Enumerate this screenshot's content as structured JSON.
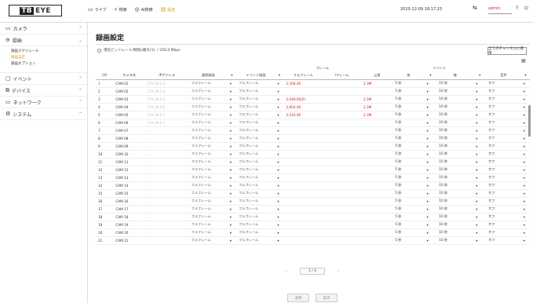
{
  "header": {
    "logo_left": "TB",
    "logo_right": "EYE",
    "nav": [
      {
        "label": "ライブ",
        "icon": "live-icon"
      },
      {
        "label": "検索",
        "icon": "search-icon"
      },
      {
        "label": "AI検索",
        "icon": "ai-search-icon"
      },
      {
        "label": "設定",
        "icon": "settings-icon"
      }
    ],
    "datetime": "2020-12-09 18:17:23",
    "user": "admin",
    "help": "?"
  },
  "sidebar": {
    "items": [
      {
        "label": "カメラ",
        "icon": "camera-icon",
        "expanded": false
      },
      {
        "label": "録画",
        "icon": "record-icon",
        "expanded": true,
        "subs": [
          "録画スケジュール",
          "録画設定",
          "録画オプション"
        ]
      },
      {
        "label": "イベント",
        "icon": "event-icon",
        "expanded": false
      },
      {
        "label": "デバイス",
        "icon": "device-icon",
        "expanded": false
      },
      {
        "label": "ネットワーク",
        "icon": "network-icon",
        "expanded": false
      },
      {
        "label": "システム",
        "icon": "system-icon",
        "expanded": false
      }
    ]
  },
  "main": {
    "title": "録画設定",
    "bitrate_label": "現在ビットレート(制限)/最大(1)",
    "bitrate_value": "/ 256.0 Mbps",
    "all_channel_btn": "全てのチャンネルに適用",
    "table": {
      "group_frame": "フレーム",
      "group_event": "イベント",
      "headers": [
        "CH",
        "カメラ名",
        "IPアドレス",
        "連続録画",
        "",
        "イベント録画",
        "",
        "フルフレーム",
        "Iフレーム",
        "上限",
        "前",
        "",
        "後",
        "",
        "音声",
        ""
      ],
      "rows": [
        [
          "1",
          "CAM 01",
          "172.30.2.3",
          "フルフレーム",
          "フルフレーム",
          "2,168.00",
          "",
          "2.3M",
          "5 秒",
          "10 秒",
          "オフ"
        ],
        [
          "2",
          "CAM 02",
          "172.30.2.4",
          "フルフレーム",
          "フルフレーム",
          "",
          "",
          "",
          "5 秒",
          "10 秒",
          "オフ"
        ],
        [
          "3",
          "CAM 03",
          "172.30.2.5",
          "フルフレーム",
          "フルフレーム",
          "2,048.00(0)",
          "",
          "2.3M",
          "5 秒",
          "10 秒",
          "オフ"
        ],
        [
          "4",
          "CAM 04",
          "172.30.2.6",
          "フルフレーム",
          "フルフレーム",
          "2,664.00",
          "",
          "2.3M",
          "5 秒",
          "10 秒",
          "オフ"
        ],
        [
          "5",
          "CAM 05",
          "172.30.2.7",
          "フルフレーム",
          "フルフレーム",
          "2,144.00",
          "",
          "2.3M",
          "5 秒",
          "10 秒",
          "オフ"
        ],
        [
          "6",
          "CAM 06",
          "172.30.1.7",
          "フルフレーム",
          "フルフレーム",
          "",
          "",
          "",
          "5 秒",
          "10 秒",
          "オフ"
        ],
        [
          "7",
          "CAM 07",
          "-",
          "フルフレーム",
          "フルフレーム",
          "",
          "",
          "",
          "5 秒",
          "10 秒",
          "オフ"
        ],
        [
          "8",
          "CAM 08",
          "-",
          "フルフレーム",
          "フルフレーム",
          "",
          "",
          "",
          "5 秒",
          "10 秒",
          "オフ"
        ],
        [
          "9",
          "CAM 09",
          "-",
          "フルフレーム",
          "フルフレーム",
          "",
          "",
          "",
          "5 秒",
          "10 秒",
          "オフ"
        ],
        [
          "10",
          "CAM 10",
          "-",
          "フルフレーム",
          "フルフレーム",
          "",
          "",
          "",
          "5 秒",
          "10 秒",
          "オフ"
        ],
        [
          "11",
          "CAM 11",
          "-",
          "フルフレーム",
          "フルフレーム",
          "",
          "",
          "",
          "5 秒",
          "10 秒",
          "オフ"
        ],
        [
          "12",
          "CAM 12",
          "-",
          "フルフレーム",
          "フルフレーム",
          "",
          "",
          "",
          "5 秒",
          "10 秒",
          "オフ"
        ],
        [
          "13",
          "CAM 13",
          "-",
          "フルフレーム",
          "フルフレーム",
          "",
          "",
          "",
          "5 秒",
          "10 秒",
          "オフ"
        ],
        [
          "14",
          "CAM 14",
          "-",
          "フルフレーム",
          "フルフレーム",
          "",
          "",
          "",
          "5 秒",
          "10 秒",
          "オフ"
        ],
        [
          "15",
          "CAM 15",
          "-",
          "フルフレーム",
          "フルフレーム",
          "",
          "",
          "",
          "5 秒",
          "10 秒",
          "オフ"
        ],
        [
          "16",
          "CAM 16",
          "-",
          "フルフレーム",
          "フルフレーム",
          "",
          "",
          "",
          "5 秒",
          "10 秒",
          "オフ"
        ],
        [
          "17",
          "CAM 17",
          "-",
          "フルフレーム",
          "フルフレーム",
          "",
          "",
          "",
          "5 秒",
          "10 秒",
          "オフ"
        ],
        [
          "18",
          "CAM 18",
          "-",
          "フルフレーム",
          "フルフレーム",
          "",
          "",
          "",
          "5 秒",
          "10 秒",
          "オフ"
        ],
        [
          "19",
          "CAM 19",
          "-",
          "フルフレーム",
          "フルフレーム",
          "",
          "",
          "",
          "5 秒",
          "10 秒",
          "オフ"
        ],
        [
          "20",
          "CAM 20",
          "-",
          "フルフレーム",
          "フルフレーム",
          "",
          "",
          "",
          "5 秒",
          "10 秒",
          "オフ"
        ],
        [
          "21",
          "CAM 21",
          "-",
          "フルフレーム",
          "フルフレーム",
          "",
          "",
          "",
          "5 秒",
          "10 秒",
          "オフ"
        ]
      ]
    },
    "pager": {
      "prev": "‹",
      "page": "1 / 4",
      "next": "›"
    },
    "apply_label": "適用",
    "cancel_label": "取消"
  },
  "colors": {
    "accent": "#d4a200",
    "alert": "#cc2222",
    "border": "#dddddd"
  }
}
